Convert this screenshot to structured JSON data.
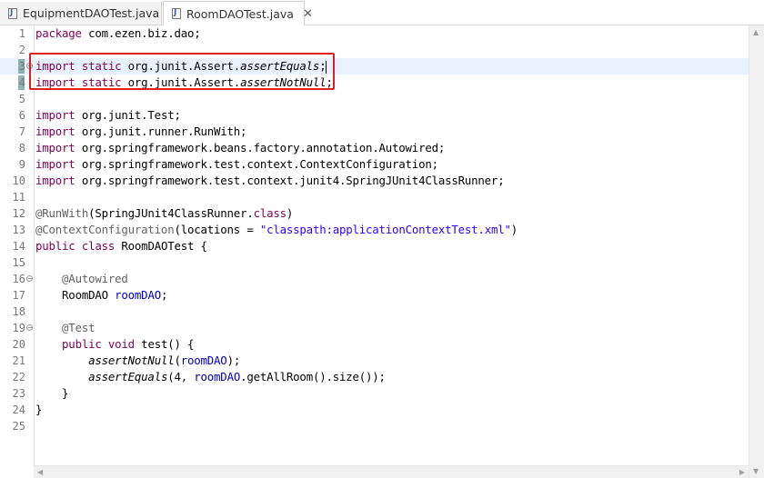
{
  "tabs": [
    {
      "label": "EquipmentDAOTest.java",
      "active": false
    },
    {
      "label": "RoomDAOTest.java",
      "active": true,
      "close": "✕"
    }
  ],
  "file_icon_glyph": "J",
  "line_numbers": [
    "1",
    "2",
    "3",
    "4",
    "5",
    "6",
    "7",
    "8",
    "9",
    "10",
    "11",
    "12",
    "13",
    "14",
    "15",
    "16",
    "17",
    "18",
    "19",
    "20",
    "21",
    "22",
    "23",
    "24",
    "25"
  ],
  "code": {
    "l1": {
      "kw": "package",
      "rest": " com.ezen.biz.dao;"
    },
    "l3": {
      "kw1": "import",
      "kw2": "static",
      "pkg": " org.junit.Assert.",
      "method": "assertEquals",
      "end": ";"
    },
    "l4": {
      "kw1": "import",
      "kw2": "static",
      "pkg": " org.junit.Assert.",
      "method": "assertNotNull",
      "end": ";"
    },
    "l6": {
      "kw": "import",
      "rest": " org.junit.Test;"
    },
    "l7": {
      "kw": "import",
      "rest": " org.junit.runner.RunWith;"
    },
    "l8": {
      "kw": "import",
      "rest": " org.springframework.beans.factory.annotation.Autowired;"
    },
    "l9": {
      "kw": "import",
      "rest": " org.springframework.test.context.ContextConfiguration;"
    },
    "l10": {
      "kw": "import",
      "rest": " org.springframework.test.context.junit4.SpringJUnit4ClassRunner;"
    },
    "l12": {
      "ann": "@RunWith",
      "pre": "(SpringJUnit4ClassRunner.",
      "kw": "class",
      "post": ")"
    },
    "l13": {
      "ann": "@ContextConfiguration",
      "pre": "(locations = ",
      "str": "\"classpath:applicationContextTest.xml\"",
      "post": ")"
    },
    "l14": {
      "kw1": "public",
      "kw2": "class",
      "rest": " RoomDAOTest {"
    },
    "l16": {
      "ann": "@Autowired"
    },
    "l17": {
      "type": "RoomDAO ",
      "field": "roomDAO",
      "end": ";"
    },
    "l19": {
      "ann": "@Test"
    },
    "l20": {
      "kw1": "public",
      "kw2": "void",
      "rest": " test() {"
    },
    "l21": {
      "method": "assertNotNull",
      "pre": "(",
      "field": "roomDAO",
      "post": ");"
    },
    "l22": {
      "method": "assertEquals",
      "pre": "(4, ",
      "field": "roomDAO",
      "post": ".getAllRoom().size());"
    },
    "l23": {
      "text": "}"
    },
    "l24": {
      "text": "}"
    }
  },
  "scroll": {
    "up": "▲",
    "down": "▼",
    "left": "◀",
    "right": "▶"
  },
  "colors": {
    "keyword": "#7f0055",
    "annotation": "#646464",
    "string": "#2a00ff",
    "field": "#0000c0",
    "highlight_box": "#e02020",
    "current_line": "#e8f2fe"
  }
}
